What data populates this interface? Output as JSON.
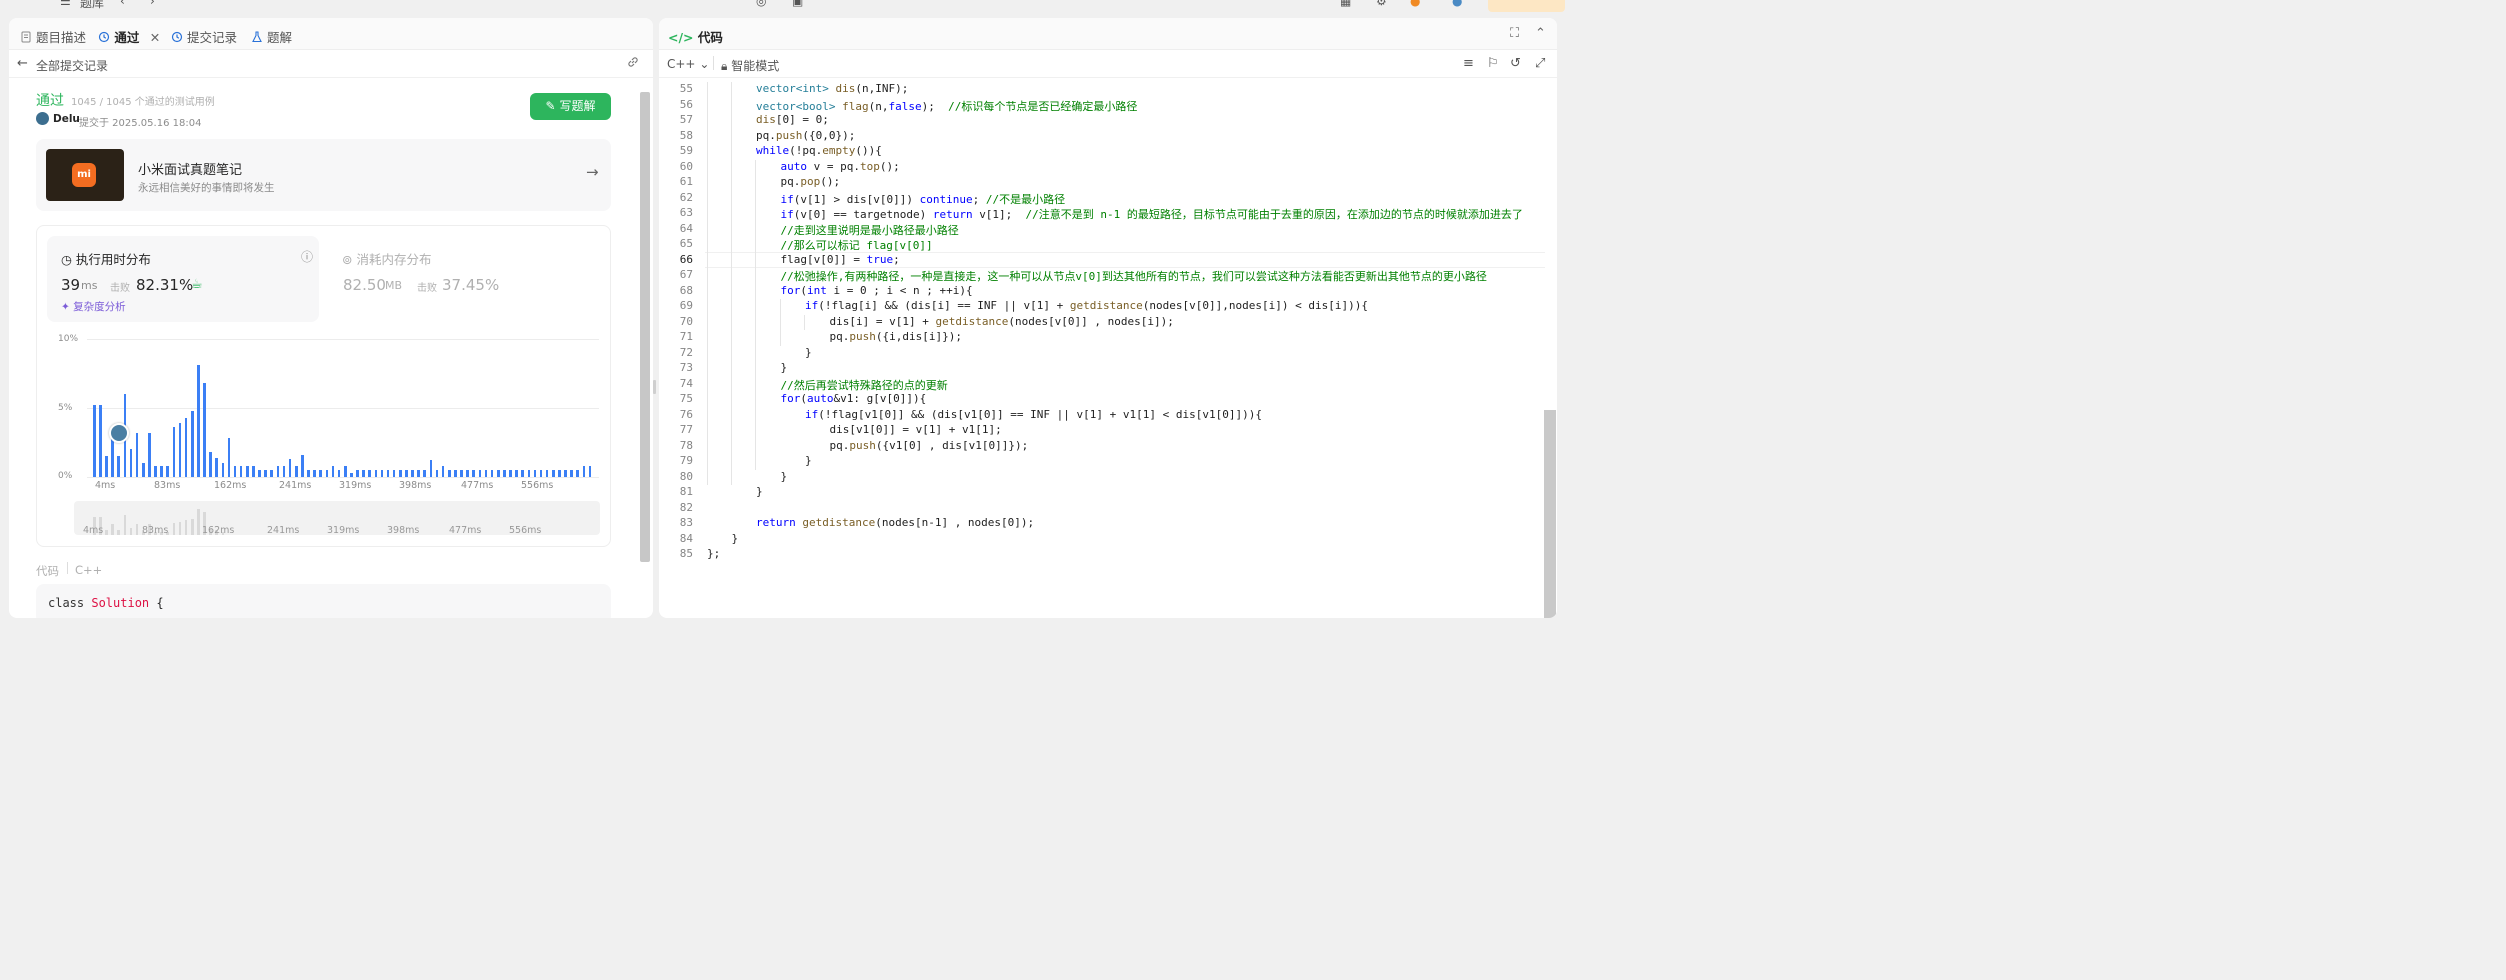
{
  "topbar": {
    "title": "题库"
  },
  "left": {
    "tabs": [
      {
        "label": "题目描述"
      },
      {
        "label": "通过"
      },
      {
        "label": "提交记录"
      },
      {
        "label": "题解"
      }
    ],
    "back_label": "全部提交记录",
    "status": "通过",
    "cases": "1045 / 1045 个通过的测试用例",
    "user": "Delu",
    "submitted": "提交于 2025.05.16 18:04",
    "write_solution": "写题解",
    "promo": {
      "title": "小米面试真题笔记",
      "subtitle": "永远相信美好的事情即将发生",
      "logo": "mi"
    },
    "runtime": {
      "tab_label": "执行用时分布",
      "value": "39",
      "unit": "ms",
      "beats_label": "击败",
      "beats": "82.31%",
      "analysis": "复杂度分析"
    },
    "memory": {
      "tab_label": "消耗内存分布",
      "value": "82.50",
      "unit": "MB",
      "beats_label": "击败",
      "beats": "37.45%"
    },
    "code_label": "代码",
    "lang_label": "C++",
    "code_preview_kw": "class",
    "code_preview_name": "Solution",
    "code_preview_brace": "{"
  },
  "chart_data": {
    "type": "bar",
    "ylabels": [
      "10%",
      "5%",
      "0%"
    ],
    "ylim": [
      0,
      10
    ],
    "xticks": [
      "4ms",
      "83ms",
      "162ms",
      "241ms",
      "319ms",
      "398ms",
      "477ms",
      "556ms"
    ],
    "values": [
      5.2,
      5.2,
      1.5,
      3.4,
      1.5,
      6.0,
      2.0,
      3.2,
      1.0,
      3.2,
      0.8,
      0.8,
      0.8,
      3.6,
      3.9,
      4.3,
      4.8,
      8.1,
      6.8,
      1.8,
      1.4,
      1.0,
      2.8,
      0.8,
      0.8,
      0.8,
      0.8,
      0.5,
      0.5,
      0.5,
      0.8,
      0.8,
      1.3,
      0.8,
      1.6,
      0.5,
      0.5,
      0.5,
      0.5,
      0.8,
      0.5,
      0.8,
      0.3,
      0.5,
      0.5,
      0.5,
      0.5,
      0.5,
      0.5,
      0.5,
      0.5,
      0.5,
      0.5,
      0.5,
      0.5,
      1.2,
      0.5,
      0.8,
      0.5,
      0.5,
      0.5,
      0.5,
      0.5,
      0.5,
      0.5,
      0.5,
      0.5,
      0.5,
      0.5,
      0.5,
      0.5,
      0.5,
      0.5,
      0.5,
      0.5,
      0.5,
      0.5,
      0.5,
      0.5,
      0.5,
      0.8,
      0.8
    ],
    "highlight_index": 5
  },
  "right": {
    "tab_label": "代码",
    "lang": "C++",
    "mode": "智能模式",
    "lines": [
      {
        "n": "55",
        "i": 2
      },
      {
        "n": "56",
        "i": 2
      },
      {
        "n": "57",
        "i": 2
      },
      {
        "n": "58",
        "i": 2
      },
      {
        "n": "59",
        "i": 2
      },
      {
        "n": "60",
        "i": 3
      },
      {
        "n": "61",
        "i": 3
      },
      {
        "n": "62",
        "i": 3
      },
      {
        "n": "63",
        "i": 3
      },
      {
        "n": "64",
        "i": 3
      },
      {
        "n": "65",
        "i": 3
      },
      {
        "n": "66",
        "i": 3
      },
      {
        "n": "67",
        "i": 3
      },
      {
        "n": "68",
        "i": 3
      },
      {
        "n": "69",
        "i": 4
      },
      {
        "n": "70",
        "i": 5
      },
      {
        "n": "71",
        "i": 5
      },
      {
        "n": "72",
        "i": 4
      },
      {
        "n": "73",
        "i": 3
      },
      {
        "n": "74",
        "i": 3
      },
      {
        "n": "75",
        "i": 3
      },
      {
        "n": "76",
        "i": 4
      },
      {
        "n": "77",
        "i": 5
      },
      {
        "n": "78",
        "i": 5
      },
      {
        "n": "79",
        "i": 4
      },
      {
        "n": "80",
        "i": 3
      },
      {
        "n": "81",
        "i": 2
      },
      {
        "n": "82",
        "i": 0
      },
      {
        "n": "83",
        "i": 2
      },
      {
        "n": "84",
        "i": 1
      },
      {
        "n": "85",
        "i": 0
      }
    ],
    "code": [
      [
        [
          "ty",
          "vector<int> "
        ],
        [
          "fn",
          "dis"
        ],
        [
          "",
          "(n,INF);"
        ]
      ],
      [
        [
          "ty",
          "vector<bool> "
        ],
        [
          "fn",
          "flag"
        ],
        [
          "",
          "(n,"
        ],
        [
          "kw",
          "false"
        ],
        [
          "",
          "); "
        ],
        [
          "cm",
          " //标识每个节点是否已经确定最小路径"
        ]
      ],
      [
        [
          "fn",
          "dis"
        ],
        [
          "",
          "[0] = 0;"
        ]
      ],
      [
        [
          "",
          "pq."
        ],
        [
          "fn",
          "push"
        ],
        [
          "",
          "({0,0});"
        ]
      ],
      [
        [
          "kw",
          "while"
        ],
        [
          "",
          "(!pq."
        ],
        [
          "fn",
          "empty"
        ],
        [
          "",
          "()){"
        ]
      ],
      [
        [
          "kw",
          "auto "
        ],
        [
          "",
          "v = pq."
        ],
        [
          "fn",
          "top"
        ],
        [
          "",
          "();"
        ]
      ],
      [
        [
          "",
          "pq."
        ],
        [
          "fn",
          "pop"
        ],
        [
          "",
          "();"
        ]
      ],
      [
        [
          "kw",
          "if"
        ],
        [
          "",
          "(v[1] > dis[v[0]]) "
        ],
        [
          "kw",
          "continue"
        ],
        [
          "",
          "; "
        ],
        [
          "cm",
          "//不是最小路径"
        ]
      ],
      [
        [
          "kw",
          "if"
        ],
        [
          "",
          "(v[0] == targetnode) "
        ],
        [
          "kw",
          "return "
        ],
        [
          "",
          "v[1];  "
        ],
        [
          "cm",
          "//注意不是到 n-1 的最短路径，目标节点可能由于去重的原因，在添加边的节点的时候就添加进去了"
        ]
      ],
      [
        [
          "cm",
          "//走到这里说明是最小路径最小路径"
        ]
      ],
      [
        [
          "cm",
          "//那么可以标记 flag[v[0]]"
        ]
      ],
      [
        [
          "",
          "flag[v[0]] = "
        ],
        [
          "kw",
          "true"
        ],
        [
          "",
          ";"
        ]
      ],
      [
        [
          "cm",
          "//松弛操作,有两种路径，一种是直接走，这一种可以从节点v[0]到达其他所有的节点，我们可以尝试这种方法看能否更新出其他节点的更小路径"
        ]
      ],
      [
        [
          "kw",
          "for"
        ],
        [
          "",
          "("
        ],
        [
          "kw",
          "int "
        ],
        [
          "",
          "i = 0 ; i < n ; ++i){"
        ]
      ],
      [
        [
          "kw",
          "if"
        ],
        [
          "",
          "(!flag[i] && (dis[i] == INF || v[1] + "
        ],
        [
          "fn",
          "getdistance"
        ],
        [
          "",
          "(nodes[v[0]],nodes[i]) < dis[i])){"
        ]
      ],
      [
        [
          "",
          "dis[i] = v[1] + "
        ],
        [
          "fn",
          "getdistance"
        ],
        [
          "",
          "(nodes[v[0]] , nodes[i]);"
        ]
      ],
      [
        [
          "",
          "pq."
        ],
        [
          "fn",
          "push"
        ],
        [
          "",
          "({i,dis[i]});"
        ]
      ],
      [
        [
          "",
          "}"
        ]
      ],
      [
        [
          "",
          "}"
        ]
      ],
      [
        [
          "cm",
          "//然后再尝试特殊路径的点的更新"
        ]
      ],
      [
        [
          "kw",
          "for"
        ],
        [
          "",
          "("
        ],
        [
          "kw",
          "auto"
        ],
        [
          "",
          "&v1: g[v[0]]){"
        ]
      ],
      [
        [
          "kw",
          "if"
        ],
        [
          "",
          "(!flag[v1[0]] && (dis[v1[0]] == INF || v[1] + v1[1] < dis[v1[0]])){"
        ]
      ],
      [
        [
          "",
          "dis[v1[0]] = v[1] + v1[1];"
        ]
      ],
      [
        [
          "",
          "pq."
        ],
        [
          "fn",
          "push"
        ],
        [
          "",
          "({v1[0] , dis[v1[0]]});"
        ]
      ],
      [
        [
          "",
          "}"
        ]
      ],
      [
        [
          "",
          "}"
        ]
      ],
      [
        [
          "",
          "}"
        ]
      ],
      [
        [
          "",
          ""
        ]
      ],
      [
        [
          "kw",
          "return "
        ],
        [
          "fn",
          "getdistance"
        ],
        [
          "",
          "(nodes[n-1] , nodes[0]);"
        ]
      ],
      [
        [
          "",
          "}"
        ]
      ],
      [
        [
          "",
          "};"
        ]
      ]
    ]
  }
}
